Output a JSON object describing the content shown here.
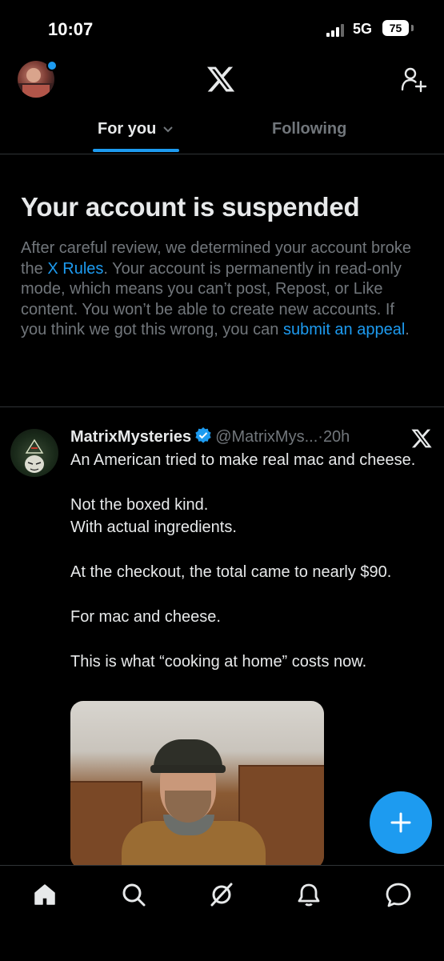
{
  "status_bar": {
    "time": "10:07",
    "network": "5G",
    "battery": "75"
  },
  "header": {
    "logo_icon": "x-logo-icon",
    "add_user_icon": "add-user-icon",
    "accent": "#1d9bf0"
  },
  "tabs": [
    {
      "label": "For you",
      "active": true
    },
    {
      "label": "Following",
      "active": false
    }
  ],
  "notice": {
    "title": "Your account is suspended",
    "body_1": "After careful review, we determined your account broke the ",
    "link_rules": "X Rules",
    "body_2": ". Your account is permanently in read-only mode, which means you can’t post, Repost, or Like content. You won’t be able to create new accounts. If you think we got this wrong, you can ",
    "link_appeal": "submit an appeal",
    "body_3": "."
  },
  "post": {
    "author": "MatrixMysteries",
    "handle": "@MatrixMys...",
    "separator": "·",
    "time": "20h",
    "lines": [
      "An American tried to make real mac and cheese.",
      "",
      "Not the boxed kind.",
      "With actual ingredients.",
      "",
      "At the checkout, the total came to nearly $90.",
      "",
      "For mac and cheese.",
      "",
      "This is what “cooking at home” costs now."
    ]
  },
  "nav": [
    "home-icon",
    "search-icon",
    "grok-icon",
    "notifications-icon",
    "messages-icon"
  ]
}
